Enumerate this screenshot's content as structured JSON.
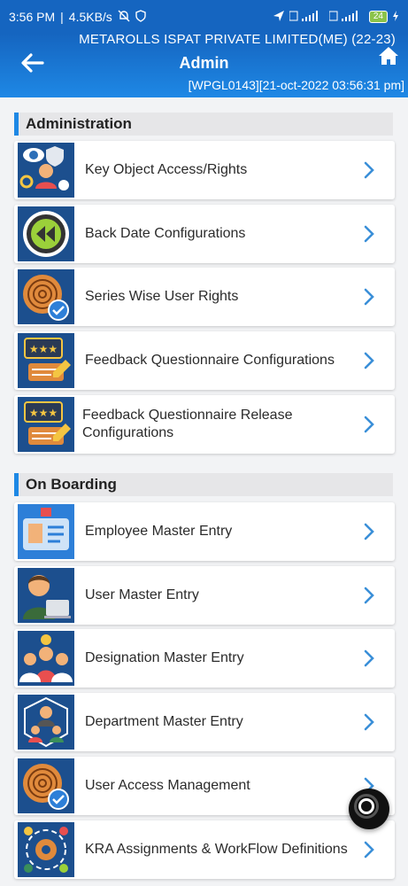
{
  "status_bar": {
    "time": "3:56 PM",
    "network_speed": "4.5KB/s",
    "battery": "24"
  },
  "header": {
    "company": "METAROLLS ISPAT PRIVATE LIMITED(ME) (22-23)",
    "title": "Admin",
    "user_stamp": "[WPGL0143][21-oct-2022 03:56:31 pm]"
  },
  "sections": [
    {
      "title": "Administration",
      "items": [
        {
          "label": "Key Object Access/Rights",
          "icon": "key-access-icon"
        },
        {
          "label": "Back Date Configurations",
          "icon": "rewind-icon"
        },
        {
          "label": "Series Wise User Rights",
          "icon": "fingerprint-check-icon"
        },
        {
          "label": "Feedback Questionnaire Configurations",
          "icon": "feedback-stars-icon"
        },
        {
          "label": "Feedback Questionnaire Release Configurations",
          "icon": "feedback-stars-icon"
        }
      ]
    },
    {
      "title": "On Boarding",
      "items": [
        {
          "label": "Employee Master Entry",
          "icon": "id-card-icon"
        },
        {
          "label": "User Master Entry",
          "icon": "user-laptop-icon"
        },
        {
          "label": "Designation Master Entry",
          "icon": "team-idea-icon"
        },
        {
          "label": "Department Master Entry",
          "icon": "department-people-icon"
        },
        {
          "label": "User Access Management",
          "icon": "fingerprint-check-icon"
        },
        {
          "label": "KRA Assignments & WorkFlow Definitions",
          "icon": "gear-workflow-icon"
        }
      ]
    }
  ],
  "colors": {
    "header": "#1565c0",
    "accent": "#1e88e5",
    "chevron": "#3a8fd8"
  }
}
